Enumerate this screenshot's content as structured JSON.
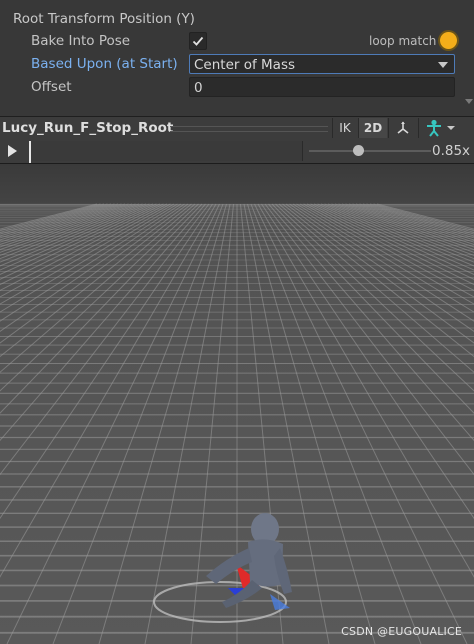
{
  "inspector": {
    "section_title": "Root Transform Position (Y)",
    "bake_label": "Bake Into Pose",
    "bake_checked": true,
    "loop_match_label": "loop match",
    "loop_match_color": "#f4ae1a",
    "based_upon_label": "Based Upon (at Start)",
    "based_upon_value": "Center of Mass",
    "offset_label": "Offset",
    "offset_value": "0"
  },
  "preview": {
    "clip_name": "Lucy_Run_F_Stop_Root",
    "ik_label": "IK",
    "mode_2d_label": "2D",
    "pivot_icon": "pivot-icon",
    "avatar_icon": "avatar-icon",
    "speed_value": "0.85x",
    "speed_fraction": 0.4,
    "play_icon": "play-icon"
  },
  "viewport": {
    "watermark": "CSDN @EUGOUALICE",
    "accent_color": "#37c6c0"
  }
}
